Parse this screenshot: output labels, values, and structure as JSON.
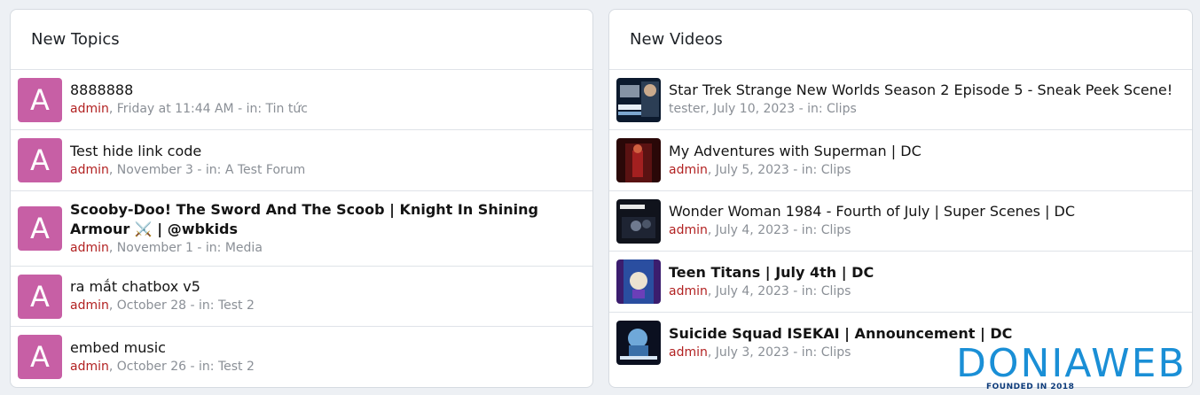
{
  "topics": {
    "title": "New Topics",
    "items": [
      {
        "avatar": "A",
        "title": "8888888",
        "user": "admin",
        "meta": ", Friday at 11:44 AM - in: Tin tức",
        "bold": false
      },
      {
        "avatar": "A",
        "title": "Test hide link code",
        "user": "admin",
        "meta": ", November 3 - in: A Test Forum",
        "bold": false
      },
      {
        "avatar": "A",
        "title": "Scooby-Doo! The Sword And The Scoob | Knight In Shining Armour ⚔️ | @wbkids",
        "user": "admin",
        "meta": ", November 1 - in: Media",
        "bold": true
      },
      {
        "avatar": "A",
        "title": "ra mắt chatbox v5",
        "user": "admin",
        "meta": ", October 28 - in: Test 2",
        "bold": false
      },
      {
        "avatar": "A",
        "title": "embed music",
        "user": "admin",
        "meta": ", October 26 - in: Test 2",
        "bold": false
      }
    ]
  },
  "videos": {
    "title": "New Videos",
    "items": [
      {
        "thumb": "startrek-thumbnail",
        "title": "Star Trek Strange New Worlds Season 2 Episode 5 - Sneak Peek Scene!",
        "user": "tester",
        "meta": ", July 10, 2023 - in: Clips",
        "bold": false,
        "user_color": "#8a8f96"
      },
      {
        "thumb": "superman-thumbnail",
        "title": "My Adventures with Superman | DC",
        "user": "admin",
        "meta": ", July 5, 2023 - in: Clips",
        "bold": false,
        "user_color": "#b22222"
      },
      {
        "thumb": "wonderwoman-thumbnail",
        "title": "Wonder Woman 1984 - Fourth of July | Super Scenes | DC",
        "user": "admin",
        "meta": ", July 4, 2023 - in: Clips",
        "bold": false,
        "user_color": "#b22222"
      },
      {
        "thumb": "teentitans-thumbnail",
        "title": "Teen Titans | July 4th | DC",
        "user": "admin",
        "meta": ", July 4, 2023 - in: Clips",
        "bold": true,
        "user_color": "#b22222"
      },
      {
        "thumb": "suicidesquad-thumbnail",
        "title": "Suicide Squad ISEKAI | Announcement | DC",
        "user": "admin",
        "meta": ", July 3, 2023 - in: Clips",
        "bold": true,
        "user_color": "#b22222"
      }
    ]
  },
  "watermark": {
    "name": "DONIAWEB",
    "tagline": "FOUNDED IN 2018"
  },
  "colors": {
    "avatar": "#c75fa5",
    "user_link": "#b22222",
    "meta": "#8a8f96",
    "brand": "#1a8fd6"
  }
}
